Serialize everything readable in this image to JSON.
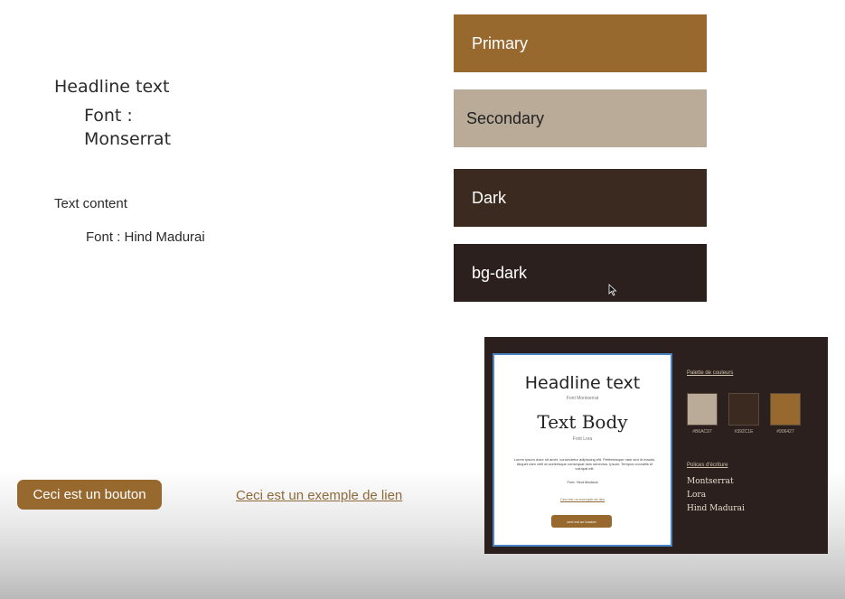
{
  "colors": {
    "primary": "#97692F",
    "secondary": "#B9AB97",
    "dark": "#3A2A20",
    "bg_dark": "#2B201D",
    "swatch_text_light": "#FFFFFF",
    "swatch_text_dark": "#222222",
    "link": "#8E6A3A"
  },
  "typography": {
    "headline_label": "Headline text",
    "headline_font_line1": "Font :",
    "headline_font_line2": "Monserrat",
    "text_content_label": "Text content",
    "text_content_font": "Font : Hind Madurai"
  },
  "swatches": {
    "primary": "Primary",
    "secondary": "Secondary",
    "dark": "Dark",
    "bg_dark": "bg-dark"
  },
  "cursor_icon": "arrow-cursor",
  "demo": {
    "button_label": "Ceci est un bouton",
    "link_label": "Ceci est un exemple de lien"
  },
  "preview": {
    "headline": "Headline text",
    "headline_font": "Font Montserrat",
    "body_title": "Text Body",
    "body_font": "Font Lora",
    "paragraph": "Lorem ipsum dolor sit amet, consectetur adipiscing elit. Pellentesque nam sed id mauris. Aliquet nam velit at scelerisque consequat duis senectus. Ipsum. Tempus convallis et volutpat elit.",
    "paragraph_font": "Font: Hind Madurai",
    "link": "Ceci est un exemple de lien",
    "button": "ceci est un bouton",
    "palette_title": "Palette de couleurs",
    "palette": [
      {
        "color": "#B9AB97",
        "hex": "#B6AC97"
      },
      {
        "color": "#3A2A20",
        "hex": "#392C1E"
      },
      {
        "color": "#97692F",
        "hex": "#906427"
      }
    ],
    "fonts_title": "Polices d'écriture",
    "fonts": [
      "Montserrat",
      "Lora",
      "Hind Madurai"
    ]
  }
}
